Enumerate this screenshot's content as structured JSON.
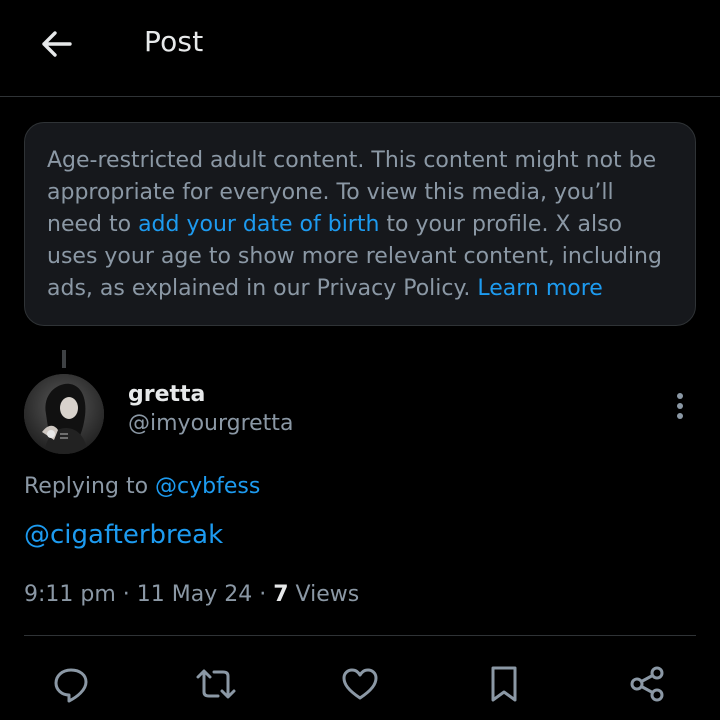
{
  "header": {
    "title": "Post",
    "back_icon": "arrow-left-icon"
  },
  "notice": {
    "text_part1": "Age-restricted adult content. This content might not be appropriate for everyone. To view this media, you’ll need to ",
    "dob_link": "add your date of birth",
    "text_part2": " to your profile. X also uses your age to show more relevant content, including ads, as explained in our Privacy Policy. ",
    "learn_more": "Learn more"
  },
  "post": {
    "display_name": "gretta",
    "handle": "@imyourgretta",
    "replying_prefix": "Replying to ",
    "replying_to": "@cybfess",
    "text": "@cigafterbreak",
    "time": "9:11 pm",
    "separator": " · ",
    "date": "11 May 24",
    "views_count": "7",
    "views_label": " Views"
  },
  "actions": [
    {
      "icon": "reply-icon"
    },
    {
      "icon": "repost-icon"
    },
    {
      "icon": "like-icon"
    },
    {
      "icon": "bookmark-icon"
    },
    {
      "icon": "share-icon"
    }
  ],
  "colors": {
    "background": "#000000",
    "text_primary": "#e7e9ea",
    "text_secondary": "#8b98a5",
    "accent": "#1d9bf0",
    "border": "#2f3336",
    "notice_bg": "#16181c"
  }
}
